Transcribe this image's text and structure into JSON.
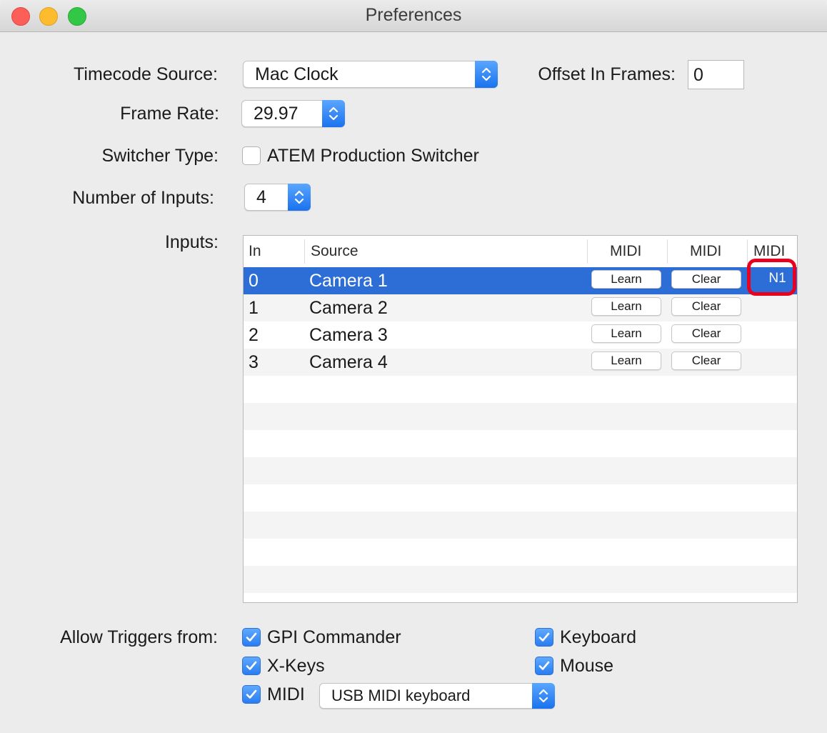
{
  "window": {
    "title": "Preferences"
  },
  "timecode_source": {
    "label": "Timecode Source:",
    "value": "Mac Clock"
  },
  "offset": {
    "label": "Offset In Frames:",
    "value": "0"
  },
  "frame_rate": {
    "label": "Frame Rate:",
    "value": "29.97"
  },
  "switcher_type": {
    "label": "Switcher Type:",
    "checkbox_label": "ATEM Production Switcher",
    "checked": false
  },
  "num_inputs": {
    "label": "Number of Inputs:",
    "value": "4"
  },
  "inputs": {
    "label": "Inputs:",
    "columns": [
      "In",
      "Source",
      "MIDI",
      "MIDI",
      "MIDI"
    ],
    "rows": [
      {
        "in": "0",
        "source": "Camera 1",
        "learn": "Learn",
        "clear": "Clear",
        "midi": "N1",
        "selected": true
      },
      {
        "in": "1",
        "source": "Camera 2",
        "learn": "Learn",
        "clear": "Clear",
        "midi": ""
      },
      {
        "in": "2",
        "source": "Camera 3",
        "learn": "Learn",
        "clear": "Clear",
        "midi": ""
      },
      {
        "in": "3",
        "source": "Camera 4",
        "learn": "Learn",
        "clear": "Clear",
        "midi": ""
      }
    ]
  },
  "triggers": {
    "label": "Allow Triggers from:",
    "gpi": {
      "label": "GPI Commander",
      "checked": true
    },
    "xkeys": {
      "label": "X-Keys",
      "checked": true
    },
    "midi": {
      "label": "MIDI",
      "checked": true
    },
    "keyboard": {
      "label": "Keyboard",
      "checked": true
    },
    "mouse": {
      "label": "Mouse",
      "checked": true
    },
    "midi_device": "USB MIDI keyboard"
  },
  "colors": {
    "accent": "#2d6dd6",
    "highlight": "#e9001e"
  }
}
